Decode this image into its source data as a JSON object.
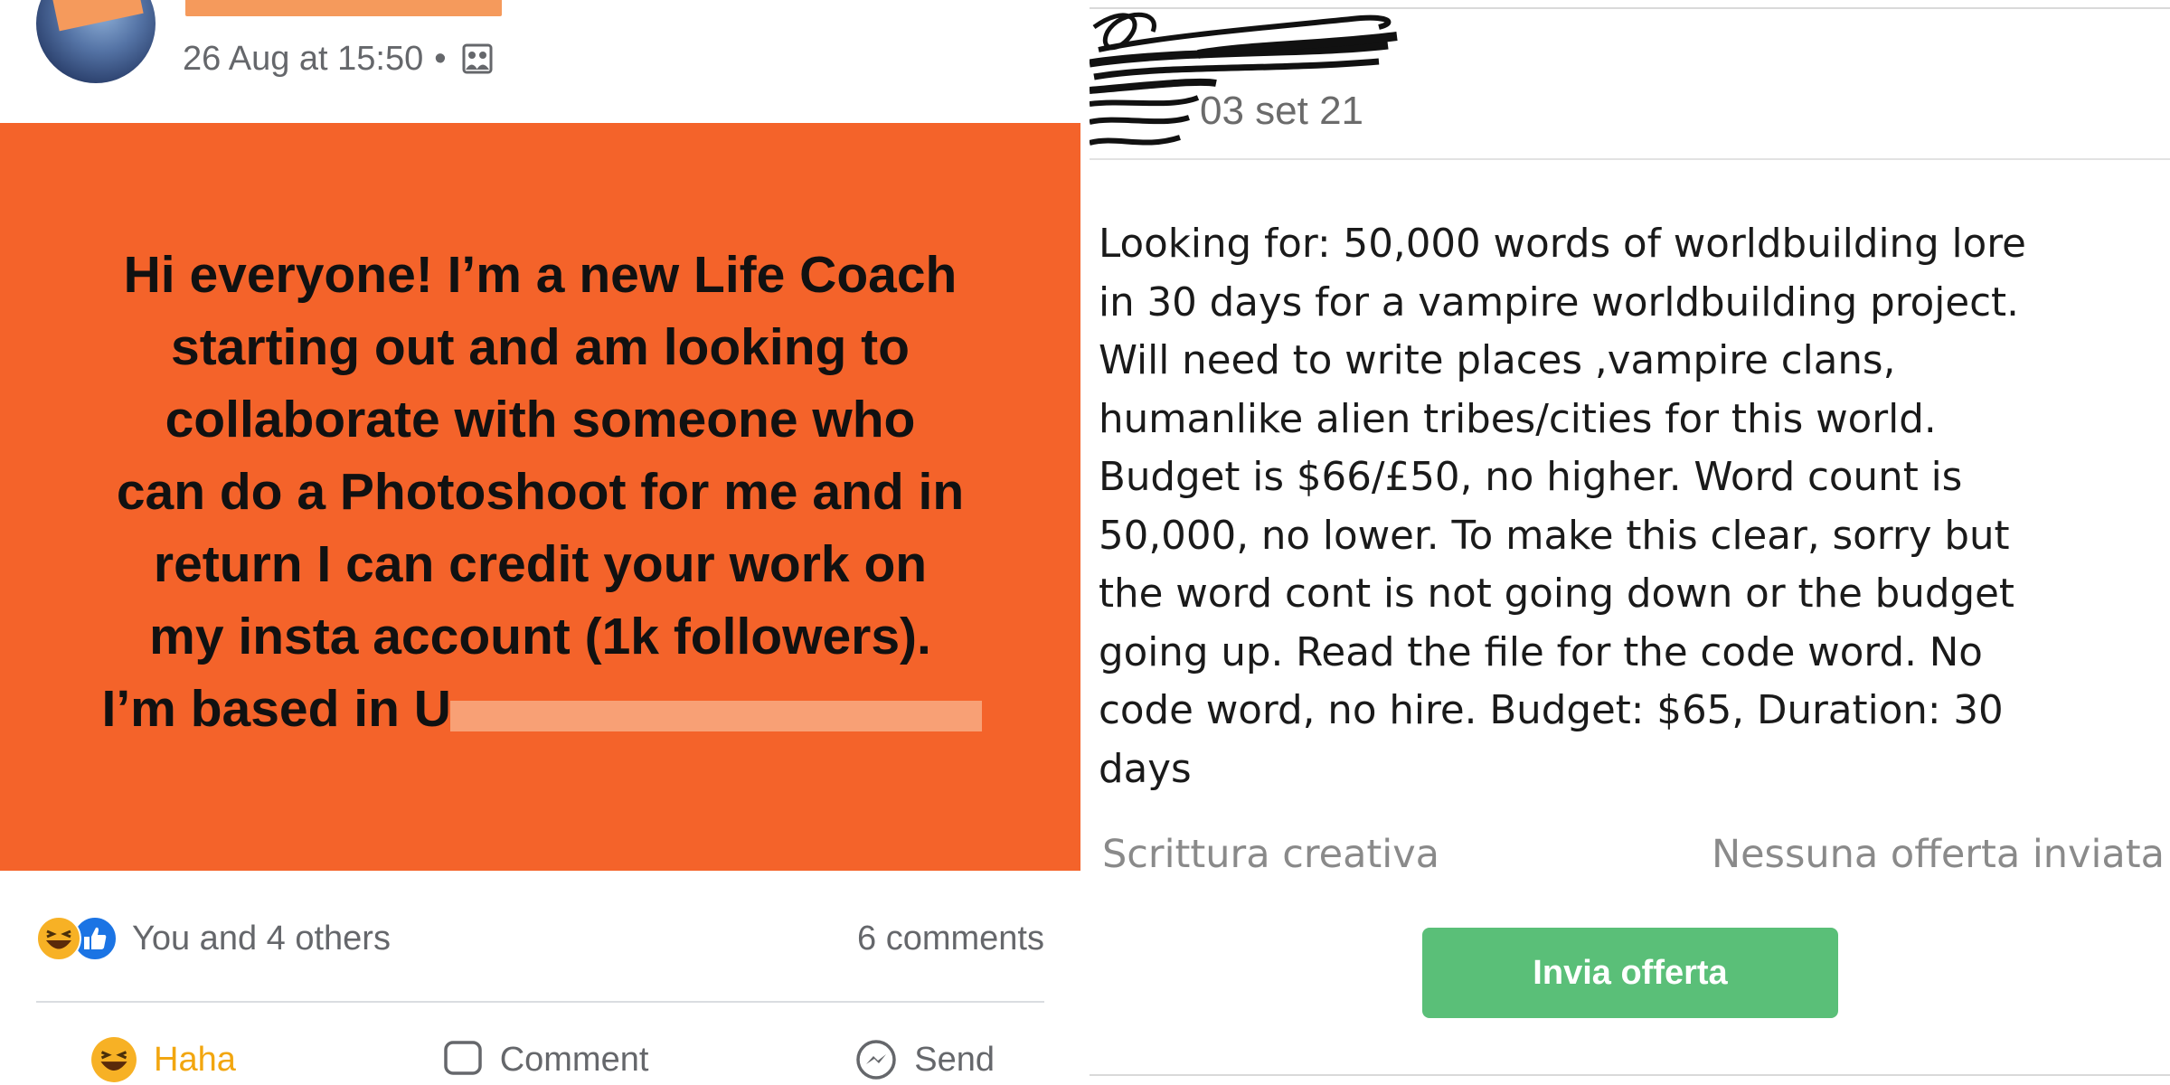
{
  "left_post": {
    "timestamp": "26 Aug at 15:50",
    "separator": "•",
    "audience_icon": "group-audience-icon",
    "card_color": "#f4632a",
    "card_lines": [
      "Hi everyone! I’m a new Life Coach",
      "starting out and am looking to",
      "collaborate with someone who",
      "can do a Photoshoot for me and in",
      "return I can credit your work on",
      "my insta account (1k followers).",
      "I’m based in U"
    ],
    "reactions_text": "You and 4 others",
    "comments_text": "6 comments",
    "actions": {
      "haha": "Haha",
      "comment": "Comment",
      "send": "Send"
    }
  },
  "right_listing": {
    "date": "03 set 21",
    "body_lines": [
      "Looking for: 50,000 words of worldbuilding lore",
      "in 30 days for a vampire worldbuilding project.",
      "Will need to write places ,vampire clans,",
      "humanlike alien tribes/cities for this world.",
      "Budget is $66/£50, no higher. Word count is",
      "50,000, no lower. To make this clear, sorry but",
      "the word cont is not going down or the budget",
      "going up. Read the file for the code word. No",
      "code word, no hire. Budget: $65, Duration: 30",
      "days"
    ],
    "category": "Scrittura creativa",
    "offer_status": "Nessuna offerta inviata",
    "button_label": "Invia offerta",
    "button_color": "#5abf78"
  }
}
